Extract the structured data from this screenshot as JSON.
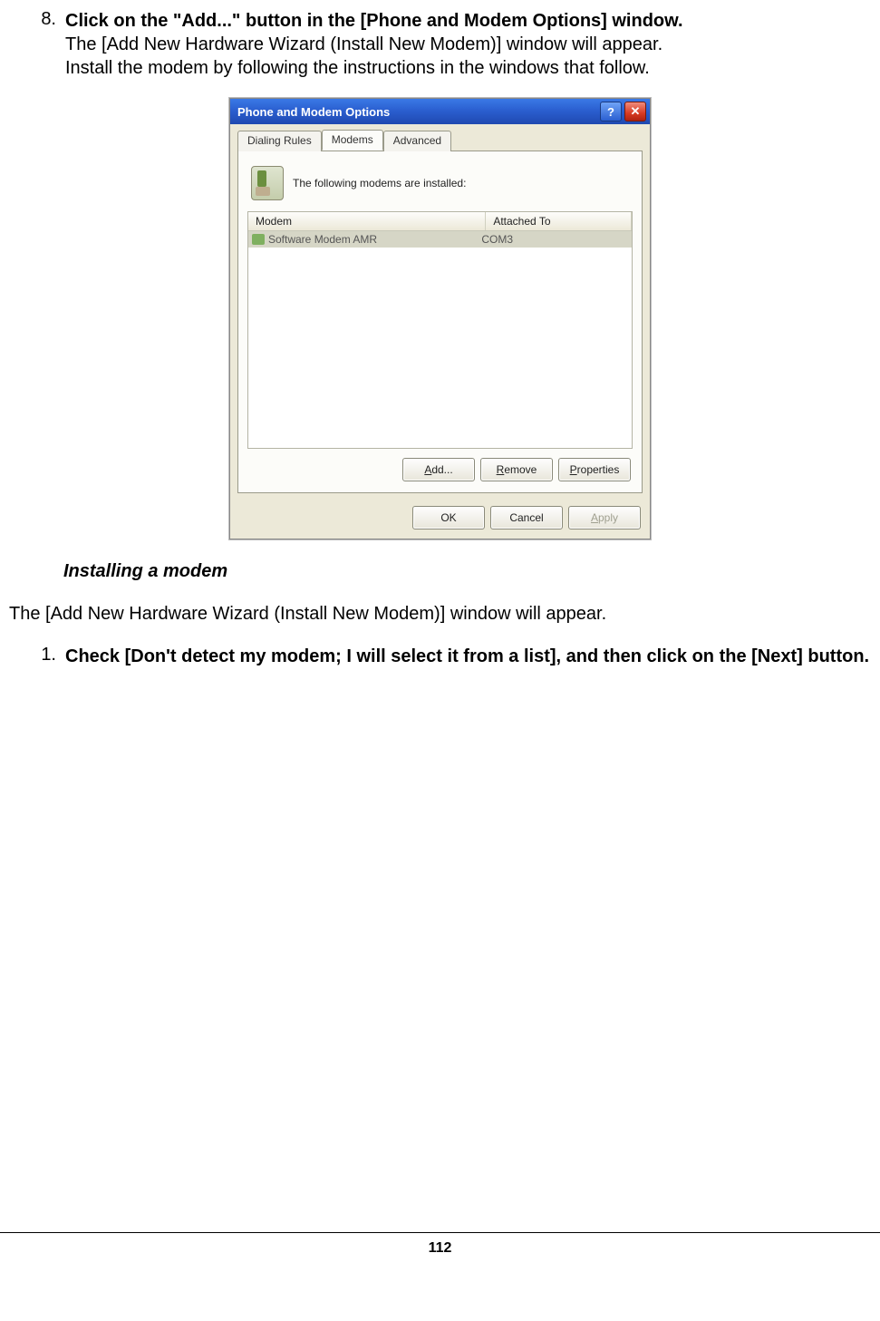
{
  "step8": {
    "number": "8.",
    "bold": "Click on the \"Add...\" button in the [Phone and Modem Options] window.",
    "line2": "The [Add New Hardware Wizard (Install New Modem)] window will appear.",
    "line3": "Install the modem by following the instructions in the windows that follow."
  },
  "dialog": {
    "title": "Phone and Modem Options",
    "tabs": {
      "t1": "Dialing Rules",
      "t2": "Modems",
      "t3": "Advanced"
    },
    "info_text": "The following modems are  installed:",
    "columns": {
      "c1": "Modem",
      "c2": "Attached To"
    },
    "row": {
      "name": "Software Modem AMR",
      "port": "COM3"
    },
    "panel_buttons": {
      "add_pre": "A",
      "add_post": "dd...",
      "remove_pre": "R",
      "remove_post": "emove",
      "props_pre": "P",
      "props_post": "roperties"
    },
    "dlg_buttons": {
      "ok": "OK",
      "cancel": "Cancel",
      "apply_pre": "A",
      "apply_post": "pply"
    }
  },
  "section_heading": "Installing a modem",
  "para2": "The [Add New Hardware Wizard (Install New Modem)] window will appear.",
  "step1": {
    "number": "1.",
    "bold": "Check [Don't detect my modem; I will select it from a list], and then click on the [Next] button."
  },
  "page_number": "112"
}
